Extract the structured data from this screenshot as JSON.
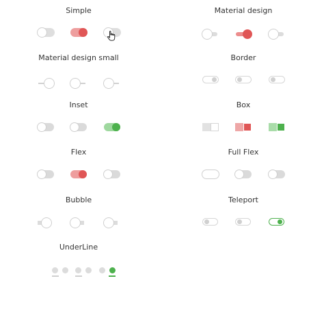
{
  "sections": {
    "simple": "Simple",
    "material_design": "Material design",
    "material_design_small": "Material design small",
    "border": "Border",
    "inset": "Inset",
    "box": "Box",
    "flex": "Flex",
    "full_flex": "Full Flex",
    "bubble": "Bubble",
    "teleport": "Teleport",
    "underline": "UnderLine"
  },
  "colors": {
    "active_red": "#e05656",
    "active_green": "#4db14d",
    "inactive_gray": "#dcdcdc"
  },
  "cursor_icon": "hand-pointer-icon"
}
